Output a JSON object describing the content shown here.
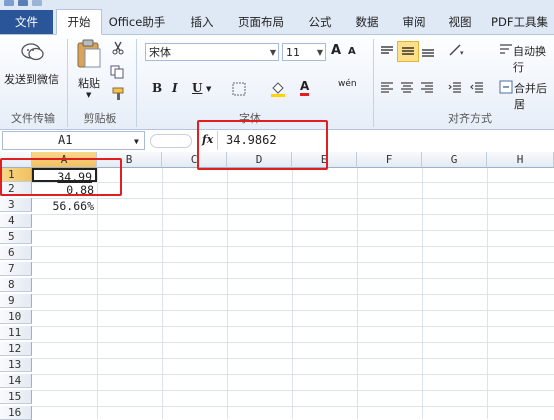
{
  "tabs": [
    "文件",
    "开始",
    "Office助手",
    "插入",
    "页面布局",
    "公式",
    "数据",
    "审阅",
    "视图",
    "PDF工具集"
  ],
  "ribbon": {
    "send_wechat": "发送到微信",
    "paste": "粘贴",
    "font_name": "宋体",
    "font_size": "11",
    "wrap_text": "自动换行",
    "merge_center": "合并后居",
    "groups": [
      "文件传输",
      "剪贴板",
      "字体",
      "对齐方式"
    ],
    "bold": "B",
    "italic": "I",
    "underline": "U",
    "grow_font": "A",
    "shrink_font": "A",
    "wen": "wén",
    "font_color": "A"
  },
  "formula_bar": {
    "name_box": "A1",
    "fx": "fx",
    "value": "34.9862"
  },
  "columns": [
    "A",
    "B",
    "C",
    "D",
    "E",
    "F",
    "G",
    "H"
  ],
  "rows": [
    "1",
    "2",
    "3",
    "4",
    "5",
    "6",
    "7",
    "8",
    "9",
    "10",
    "11",
    "12",
    "13",
    "14",
    "15",
    "16"
  ],
  "cells": {
    "A1": "34.99",
    "A2": "0.88",
    "A3": "56.66%"
  },
  "colors": {
    "file_tab": "#2a5699",
    "highlight_box": "#e02020",
    "selected_header": "#f1c15f"
  }
}
